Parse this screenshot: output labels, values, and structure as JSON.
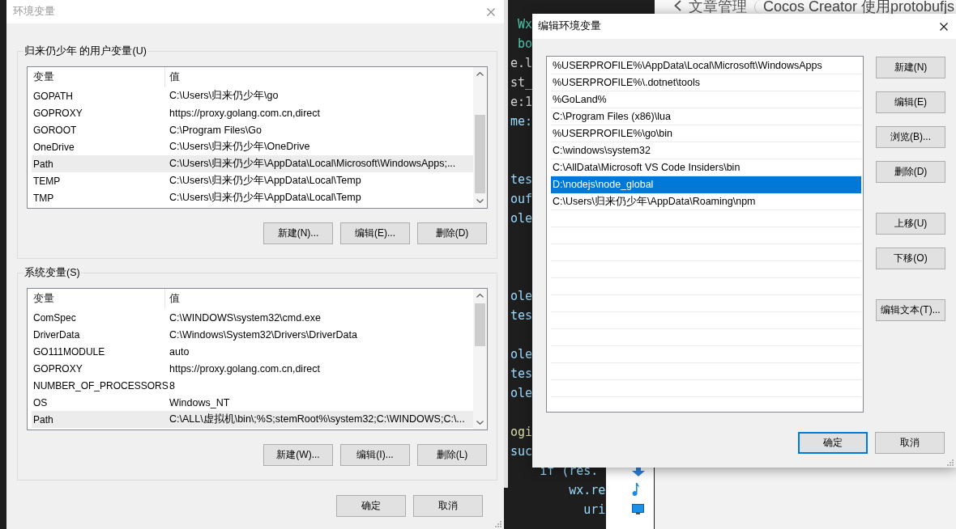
{
  "code_editor": {
    "lines": [
      {
        "text": " Wx",
        "kind": "type"
      },
      {
        "text": " bo",
        "kind": "type"
      },
      {
        "text": "e.l",
        "kind": "plain"
      },
      {
        "text": "st_",
        "kind": "plain"
      },
      {
        "text": "e:1",
        "kind": "plain"
      },
      {
        "text": "me:",
        "kind": "variable"
      },
      {
        "text": "tes",
        "kind": "variable"
      },
      {
        "text": "ouf",
        "kind": "variable"
      },
      {
        "text": "ole",
        "kind": "variable"
      },
      {
        "text": "ole",
        "kind": "variable"
      },
      {
        "text": "tes",
        "kind": "variable"
      },
      {
        "text": "ole",
        "kind": "variable"
      },
      {
        "text": "tes",
        "kind": "variable"
      },
      {
        "text": "ole",
        "kind": "variable"
      },
      {
        "text": "ogi",
        "kind": "function"
      },
      {
        "text": "suc",
        "kind": "variable"
      },
      {
        "text": "    if (res.",
        "kind": "variable"
      },
      {
        "text": "        wx.re",
        "kind": "variable"
      },
      {
        "text": "          uri",
        "kind": "variable"
      }
    ]
  },
  "browser": {
    "breadcrumb": "文章管理",
    "title_input": "Cocos Creator 使用protobufjs"
  },
  "env_vars_dialog": {
    "title": "环境变量",
    "active": false,
    "groups": [
      {
        "label": "归来仍少年 的用户变量(U)",
        "columns": [
          "变量",
          "值"
        ],
        "rows": [
          {
            "name": "GOPATH",
            "value": "C:\\Users\\归来仍少年\\go",
            "selected": false
          },
          {
            "name": "GOPROXY",
            "value": "https://proxy.golang.com.cn,direct",
            "selected": false
          },
          {
            "name": "GOROOT",
            "value": "C:\\Program Files\\Go",
            "selected": false
          },
          {
            "name": "OneDrive",
            "value": "C:\\Users\\归来仍少年\\OneDrive",
            "selected": false
          },
          {
            "name": "Path",
            "value": "C:\\Users\\归来仍少年\\AppData\\Local\\Microsoft\\WindowsApps;...",
            "selected": true
          },
          {
            "name": "TEMP",
            "value": "C:\\Users\\归来仍少年\\AppData\\Local\\Temp",
            "selected": false
          },
          {
            "name": "TMP",
            "value": "C:\\Users\\归来仍少年\\AppData\\Local\\Temp",
            "selected": false
          }
        ],
        "buttons": [
          "新建(N)...",
          "编辑(E)...",
          "删除(D)"
        ]
      },
      {
        "label": "系统变量(S)",
        "columns": [
          "变量",
          "值"
        ],
        "rows": [
          {
            "name": "ComSpec",
            "value": "C:\\WINDOWS\\system32\\cmd.exe",
            "selected": false
          },
          {
            "name": "DriverData",
            "value": "C:\\Windows\\System32\\Drivers\\DriverData",
            "selected": false
          },
          {
            "name": "GO111MODULE",
            "value": "auto",
            "selected": false
          },
          {
            "name": "GOPROXY",
            "value": "https://proxy.golang.com.cn,direct",
            "selected": false
          },
          {
            "name": "NUMBER_OF_PROCESSORS",
            "value": "8",
            "selected": false
          },
          {
            "name": "OS",
            "value": "Windows_NT",
            "selected": false
          },
          {
            "name": "Path",
            "value": "C:\\ALL\\虚拟机\\bin\\;%S;stemRoot%\\system32;C:\\WINDOWS;C:\\...",
            "selected": true
          }
        ],
        "buttons": [
          "新建(W)...",
          "编辑(I)...",
          "删除(L)"
        ]
      }
    ],
    "buttons": [
      {
        "label": "确定",
        "default": false
      },
      {
        "label": "取消",
        "default": false
      }
    ]
  },
  "edit_path_dialog": {
    "title": "编辑环境变量",
    "active": true,
    "entries": [
      {
        "text": "%USERPROFILE%\\AppData\\Local\\Microsoft\\WindowsApps",
        "selected": false
      },
      {
        "text": "%USERPROFILE%\\.dotnet\\tools",
        "selected": false
      },
      {
        "text": "%GoLand%",
        "selected": false
      },
      {
        "text": "C:\\Program Files (x86)\\lua",
        "selected": false
      },
      {
        "text": "%USERPROFILE%\\go\\bin",
        "selected": false
      },
      {
        "text": "C:\\windows\\system32",
        "selected": false
      },
      {
        "text": "C:\\AllData\\Microsoft VS Code Insiders\\bin",
        "selected": false
      },
      {
        "text": "D:\\nodejs\\node_global",
        "selected": true
      },
      {
        "text": "C:\\Users\\归来仍少年\\AppData\\Roaming\\npm",
        "selected": false
      }
    ],
    "button_groups": [
      [
        "新建(N)",
        "编辑(E)",
        "浏览(B)...",
        "删除(D)"
      ],
      [
        "上移(U)",
        "下移(O)"
      ],
      [
        "编辑文本(T)..."
      ]
    ],
    "buttons": [
      {
        "label": "确定",
        "default": true
      },
      {
        "label": "取消",
        "default": false
      }
    ]
  }
}
